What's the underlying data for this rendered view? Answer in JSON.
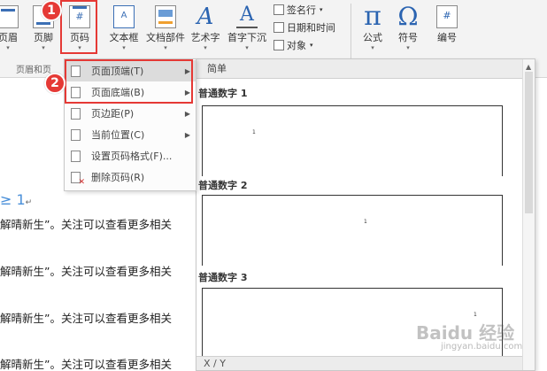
{
  "ribbon": {
    "buttons": {
      "header": "页眉",
      "footer": "页脚",
      "page_number": "页码",
      "text_box": "文本框",
      "quick_parts": "文档部件",
      "wordart": "艺术字",
      "drop_cap": "首字下沉",
      "equation": "公式",
      "symbol": "符号",
      "number": "编号"
    },
    "small_commands": {
      "signature_line": "签名行",
      "date_time": "日期和时间",
      "object": "对象"
    },
    "group_label": "页眉和页",
    "icon_glyphs": {
      "page_number": "#",
      "text_box": "A",
      "wordart": "A",
      "drop_cap": "A",
      "equation": "π",
      "symbol": "Ω",
      "number": "#"
    }
  },
  "annotations": {
    "step1": "1",
    "step2": "2",
    "highlight_color": "#e53935"
  },
  "menu": {
    "items": [
      {
        "label": "页面顶端(T)",
        "has_submenu": true
      },
      {
        "label": "页面底端(B)",
        "has_submenu": true
      },
      {
        "label": "页边距(P)",
        "has_submenu": true
      },
      {
        "label": "当前位置(C)",
        "has_submenu": true
      },
      {
        "label": "设置页码格式(F)...",
        "has_submenu": false
      },
      {
        "label": "删除页码(R)",
        "has_submenu": false
      }
    ]
  },
  "gallery": {
    "header": "简单",
    "items": [
      {
        "label": "普通数字 1",
        "sample": "1"
      },
      {
        "label": "普通数字 2",
        "sample": "1"
      },
      {
        "label": "普通数字 3",
        "sample": "1"
      }
    ],
    "footer": "X / Y"
  },
  "document": {
    "heading": "≥ 1",
    "heading_mark": "↵",
    "paragraphs": [
      "解晴新生”。关注可以查看更多相关",
      "解晴新生”。关注可以查看更多相关",
      "解晴新生”。关注可以查看更多相关",
      "解晴新生”。关注可以查看更多相关"
    ]
  },
  "watermark": {
    "brand": "Baidu 经验",
    "url": "jingyan.baidu.com"
  }
}
